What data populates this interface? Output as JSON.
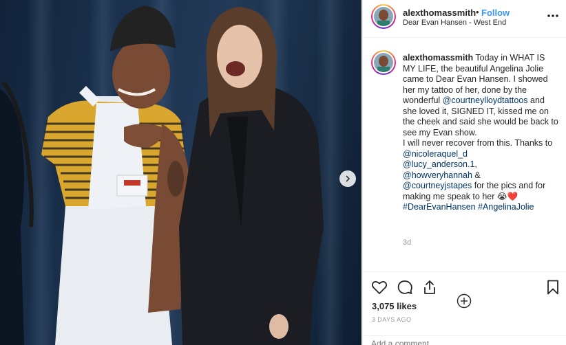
{
  "post": {
    "username": "alexthomassmith",
    "separator": "•",
    "follow_label": "Follow",
    "location": "Dear Evan Hansen - West End",
    "caption_parts": [
      "Today in WHAT IS MY LIFE, the beautiful Angelina Jolie came to Dear Evan Hansen. I showed her my tattoo of her, done by the wonderful ",
      "@courtneylloydtattoos",
      " and she loved it, SIGNED IT, kissed me on the cheek and said she would be back to see my Evan show.",
      "I will never recover from this. Thanks to ",
      "@nicoleraquel_d",
      "@lucy_anderson.1",
      ",",
      "@howveryhannah",
      " &",
      "@courtneyjstapes",
      " for the pics and for making me speak to her 😭❤️",
      "#DearEvanHansen",
      " ",
      "#AngelinaJolie"
    ],
    "time_ago": "3d",
    "likes": "3,075 likes",
    "date": "3 DAYS AGO",
    "comment_placeholder": "Add a comment..."
  },
  "icons": {
    "more": "more-dots-icon",
    "like": "heart-icon",
    "comment": "comment-bubble-icon",
    "share": "share-icon",
    "save": "bookmark-icon",
    "load_more": "plus-circle-icon",
    "next": "chevron-right-icon"
  },
  "colors": {
    "link": "#003569",
    "follow": "#3897f0",
    "muted": "#999999",
    "border": "#efefef"
  }
}
